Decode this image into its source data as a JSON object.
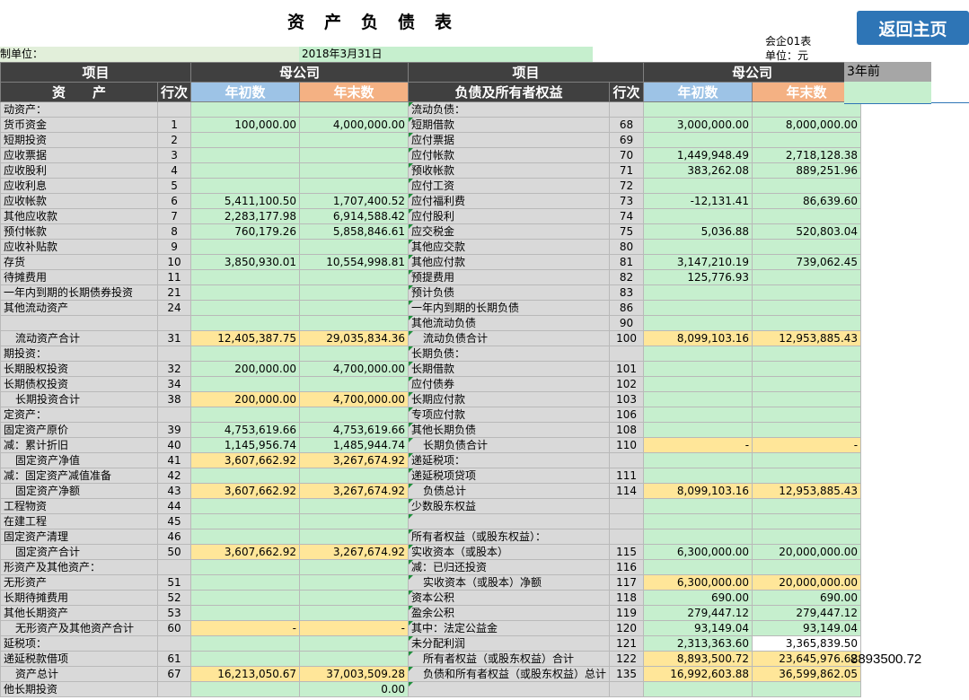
{
  "title": "资产负债表",
  "back_button": "返回主页",
  "form_code": "会企01表",
  "unit": "单位：元",
  "company_label": "制单位：",
  "date": "2018年3月31日",
  "header": {
    "item": "项目",
    "parent": "母公司",
    "assets": "资　　产",
    "row_no": "行次",
    "begin": "年初数",
    "end": "年末数",
    "liabilities": "负债及所有者权益"
  },
  "side": {
    "label": "3年前",
    "value": "8893500.72"
  },
  "rows": [
    {
      "l": "动资产：",
      "ln": "",
      "lb": "",
      "le": "",
      "r": "流动负债：",
      "rn": "",
      "rb": "",
      "re": "",
      "lk": "sec",
      "rk": "sec"
    },
    {
      "l": "货币资金",
      "ln": "1",
      "lb": "100,000.00",
      "le": "4,000,000.00",
      "r": "短期借款",
      "rn": "68",
      "rb": "3,000,000.00",
      "re": "8,000,000.00"
    },
    {
      "l": "短期投资",
      "ln": "2",
      "lb": "",
      "le": "",
      "r": "应付票据",
      "rn": "69",
      "rb": "",
      "re": ""
    },
    {
      "l": "应收票据",
      "ln": "3",
      "lb": "",
      "le": "",
      "r": "应付帐款",
      "rn": "70",
      "rb": "1,449,948.49",
      "re": "2,718,128.38"
    },
    {
      "l": "应收股利",
      "ln": "4",
      "lb": "",
      "le": "",
      "r": "预收帐款",
      "rn": "71",
      "rb": "383,262.08",
      "re": "889,251.96"
    },
    {
      "l": "应收利息",
      "ln": "5",
      "lb": "",
      "le": "",
      "r": "应付工资",
      "rn": "72",
      "rb": "",
      "re": ""
    },
    {
      "l": "应收帐款",
      "ln": "6",
      "lb": "5,411,100.50",
      "le": "1,707,400.52",
      "r": "应付福利费",
      "rn": "73",
      "rb": "-12,131.41",
      "re": "86,639.60"
    },
    {
      "l": "其他应收款",
      "ln": "7",
      "lb": "2,283,177.98",
      "le": "6,914,588.42",
      "r": "应付股利",
      "rn": "74",
      "rb": "",
      "re": ""
    },
    {
      "l": "预付帐款",
      "ln": "8",
      "lb": "760,179.26",
      "le": "5,858,846.61",
      "r": "应交税金",
      "rn": "75",
      "rb": "5,036.88",
      "re": "520,803.04"
    },
    {
      "l": "应收补贴款",
      "ln": "9",
      "lb": "",
      "le": "",
      "r": "其他应交款",
      "rn": "80",
      "rb": "",
      "re": ""
    },
    {
      "l": "存货",
      "ln": "10",
      "lb": "3,850,930.01",
      "le": "10,554,998.81",
      "r": "其他应付款",
      "rn": "81",
      "rb": "3,147,210.19",
      "re": "739,062.45"
    },
    {
      "l": "待摊费用",
      "ln": "11",
      "lb": "",
      "le": "",
      "r": "预提费用",
      "rn": "82",
      "rb": "125,776.93",
      "re": ""
    },
    {
      "l": "一年内到期的长期债券投资",
      "ln": "21",
      "lb": "",
      "le": "",
      "r": "预计负债",
      "rn": "83",
      "rb": "",
      "re": ""
    },
    {
      "l": "其他流动资产",
      "ln": "24",
      "lb": "",
      "le": "",
      "r": "一年内到期的长期负债",
      "rn": "86",
      "rb": "",
      "re": ""
    },
    {
      "l": "",
      "ln": "",
      "lb": "",
      "le": "",
      "r": "其他流动负债",
      "rn": "90",
      "rb": "",
      "re": ""
    },
    {
      "l": "流动资产合计",
      "ln": "31",
      "lb": "12,405,387.75",
      "le": "29,035,834.36",
      "r": "流动负债合计",
      "rn": "100",
      "rb": "8,099,103.16",
      "re": "12,953,885.43",
      "lk": "total",
      "rk": "total"
    },
    {
      "l": "期投资：",
      "ln": "",
      "lb": "",
      "le": "",
      "r": "长期负债：",
      "rn": "",
      "rb": "",
      "re": "",
      "lk": "sec",
      "rk": "sec"
    },
    {
      "l": "长期股权投资",
      "ln": "32",
      "lb": "200,000.00",
      "le": "4,700,000.00",
      "r": "长期借款",
      "rn": "101",
      "rb": "",
      "re": ""
    },
    {
      "l": "长期债权投资",
      "ln": "34",
      "lb": "",
      "le": "",
      "r": "应付债券",
      "rn": "102",
      "rb": "",
      "re": ""
    },
    {
      "l": "长期投资合计",
      "ln": "38",
      "lb": "200,000.00",
      "le": "4,700,000.00",
      "r": "长期应付款",
      "rn": "103",
      "rb": "",
      "re": "",
      "lk": "total"
    },
    {
      "l": "定资产：",
      "ln": "",
      "lb": "",
      "le": "",
      "r": "专项应付款",
      "rn": "106",
      "rb": "",
      "re": "",
      "lk": "sec"
    },
    {
      "l": "固定资产原价",
      "ln": "39",
      "lb": "4,753,619.66",
      "le": "4,753,619.66",
      "r": "其他长期负债",
      "rn": "108",
      "rb": "",
      "re": ""
    },
    {
      "l": "减：累计折旧",
      "ln": "40",
      "lb": "1,145,956.74",
      "le": "1,485,944.74",
      "r": "长期负债合计",
      "rn": "110",
      "rb": "-",
      "re": "-",
      "rk": "total"
    },
    {
      "l": "固定资产净值",
      "ln": "41",
      "lb": "3,607,662.92",
      "le": "3,267,674.92",
      "r": "递延税项：",
      "rn": "",
      "rb": "",
      "re": "",
      "lk": "total",
      "rk": "sec"
    },
    {
      "l": "减：固定资产减值准备",
      "ln": "42",
      "lb": "",
      "le": "",
      "r": "递延税项贷项",
      "rn": "111",
      "rb": "",
      "re": ""
    },
    {
      "l": "固定资产净额",
      "ln": "43",
      "lb": "3,607,662.92",
      "le": "3,267,674.92",
      "r": "负债总计",
      "rn": "114",
      "rb": "8,099,103.16",
      "re": "12,953,885.43",
      "lk": "total",
      "rk": "total"
    },
    {
      "l": "工程物资",
      "ln": "44",
      "lb": "",
      "le": "",
      "r": "少数股东权益",
      "rn": "",
      "rb": "",
      "re": "",
      "rk": "sec"
    },
    {
      "l": "在建工程",
      "ln": "45",
      "lb": "",
      "le": "",
      "r": "",
      "rn": "",
      "rb": "",
      "re": ""
    },
    {
      "l": "固定资产清理",
      "ln": "46",
      "lb": "",
      "le": "",
      "r": "所有者权益（或股东权益）：",
      "rn": "",
      "rb": "",
      "re": "",
      "rk": "sec"
    },
    {
      "l": "固定资产合计",
      "ln": "50",
      "lb": "3,607,662.92",
      "le": "3,267,674.92",
      "r": "实收资本（或股本）",
      "rn": "115",
      "rb": "6,300,000.00",
      "re": "20,000,000.00",
      "lk": "total"
    },
    {
      "l": "形资产及其他资产：",
      "ln": "",
      "lb": "",
      "le": "",
      "r": "减：已归还投资",
      "rn": "116",
      "rb": "",
      "re": "",
      "lk": "sec"
    },
    {
      "l": "无形资产",
      "ln": "51",
      "lb": "",
      "le": "",
      "r": "实收资本（或股本）净额",
      "rn": "117",
      "rb": "6,300,000.00",
      "re": "20,000,000.00",
      "rk": "total"
    },
    {
      "l": "长期待摊费用",
      "ln": "52",
      "lb": "",
      "le": "",
      "r": "资本公积",
      "rn": "118",
      "rb": "690.00",
      "re": "690.00"
    },
    {
      "l": "其他长期资产",
      "ln": "53",
      "lb": "",
      "le": "",
      "r": "盈余公积",
      "rn": "119",
      "rb": "279,447.12",
      "re": "279,447.12"
    },
    {
      "l": "无形资产及其他资产合计",
      "ln": "60",
      "lb": "-",
      "le": "-",
      "r": "其中：法定公益金",
      "rn": "120",
      "rb": "93,149.04",
      "re": "93,149.04",
      "lk": "total"
    },
    {
      "l": "延税项：",
      "ln": "",
      "lb": "",
      "le": "",
      "r": "未分配利润",
      "rn": "121",
      "rb": "2,313,363.60",
      "re": "3,365,839.50",
      "lk": "sec",
      "rk": "white"
    },
    {
      "l": "递延税款借项",
      "ln": "61",
      "lb": "",
      "le": "",
      "r": "所有者权益（或股东权益）合计",
      "rn": "122",
      "rb": "8,893,500.72",
      "re": "23,645,976.62",
      "rk": "total"
    },
    {
      "l": "资产总计",
      "ln": "67",
      "lb": "16,213,050.67",
      "le": "37,003,509.28",
      "r": "负债和所有者权益（或股东权益）总计",
      "rn": "135",
      "rb": "16,992,603.88",
      "re": "36,599,862.05",
      "lk": "total",
      "rk": "total"
    },
    {
      "l": "他长期投资",
      "ln": "",
      "lb": "",
      "le": "0.00",
      "r": "",
      "rn": "",
      "rb": "",
      "re": "",
      "lk": "sec"
    }
  ]
}
